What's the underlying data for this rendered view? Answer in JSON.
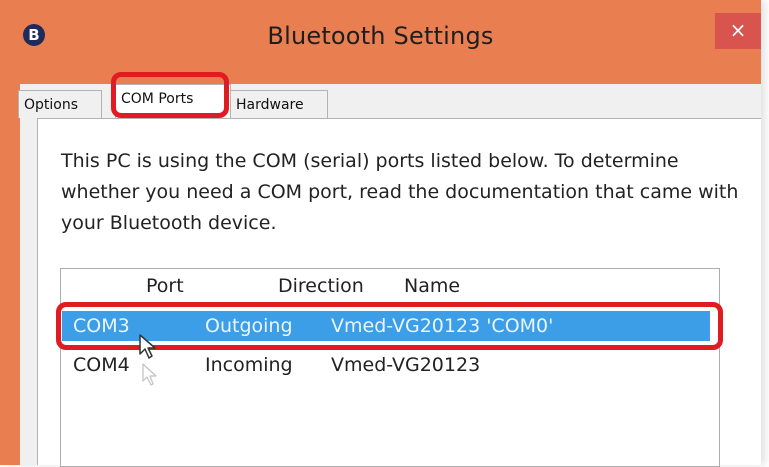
{
  "window": {
    "title": "Bluetooth Settings",
    "bluetooth_icon_glyph": "B",
    "close_glyph": "×",
    "accent_color": "#e97f50",
    "close_color": "#d9534f"
  },
  "tabs": [
    {
      "label": "Options",
      "selected": false
    },
    {
      "label": "COM Ports",
      "selected": true
    },
    {
      "label": "Hardware",
      "selected": false
    }
  ],
  "description": "This PC is using the COM (serial) ports listed below. To determine whether you need a COM port, read the documentation that came with your Bluetooth device.",
  "table": {
    "headers": [
      "Port",
      "Direction",
      "Name"
    ],
    "rows": [
      {
        "port": "COM3",
        "direction": "Outgoing",
        "name": "Vmed-VG20123 'COM0'",
        "selected": true
      },
      {
        "port": "COM4",
        "direction": "Incoming",
        "name": "Vmed-VG20123",
        "selected": false
      }
    ],
    "selection_color": "#3b9ee6"
  },
  "icons": {
    "bluetooth": "bluetooth-icon",
    "close": "close-icon",
    "cursor": "mouse-pointer-icon"
  }
}
